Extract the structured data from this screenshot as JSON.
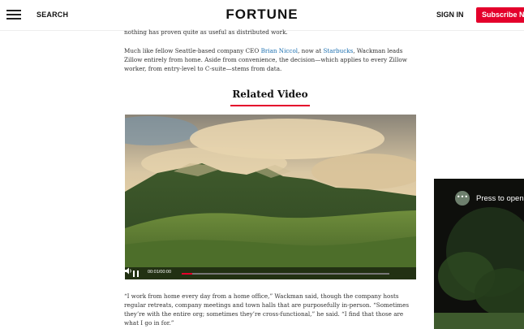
{
  "header": {
    "menu_icon": "hamburger-menu-icon",
    "search_label": "SEARCH",
    "logo": "FORTUNE",
    "signin_label": "SIGN IN",
    "subscribe_label": "Subscribe Now"
  },
  "article": {
    "p1_text": "nothing has proven quite as useful as distributed work.",
    "p2_before": "Much like fellow Seattle-based company CEO ",
    "p2_link1": "Brian Niccol",
    "p2_mid": ", now at ",
    "p2_link2": "Starbucks",
    "p2_after": ", Wackman leads Zillow entirely from home. Aside from convenience, the decision—which applies to every Zillow worker, from entry-level to C-suite—stems from data.",
    "related_title": "Related Video",
    "p3_text": "“I work from home every day from a home office,” Wackman said, though the company hosts regular retreats, company meetings and town halls that are purposefully in-person. “Sometimes they’re with the entire org; sometimes they’re cross-functional,” he said. “I find that those are what I go in for.”"
  },
  "video": {
    "timecode": "00:01/00:00",
    "progress_fraction": 0.05,
    "play_icon": "pause-icon",
    "volume_icon": "volume-icon"
  },
  "floating_player": {
    "menu_icon": "more-options-icon",
    "prompt": "Press to open"
  },
  "colors": {
    "brand_red": "#e4002b",
    "link_blue": "#1b6fb0"
  }
}
